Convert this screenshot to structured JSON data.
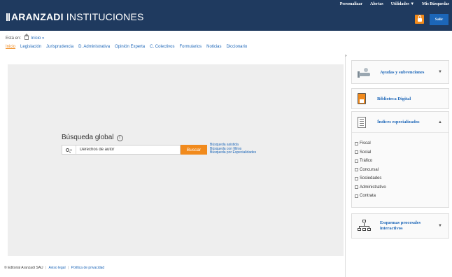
{
  "header": {
    "brand_bold": "ARANZADI",
    "brand_rest": " INSTITUCIONES",
    "links": [
      "Personalizar",
      "Alertas",
      "Utilidades ▼",
      "Mis Búsquedas"
    ],
    "logout_label": "Salir"
  },
  "breadcrumb": {
    "prefix": "Está en:",
    "home": "Inicio »"
  },
  "nav": {
    "items": [
      "Inicio",
      "Legislación",
      "Jurisprudencia",
      "D. Administrativa",
      "Opinión Experta",
      "C. Colectivos",
      "Formularios",
      "Noticias",
      "Diccionario"
    ],
    "active_index": 0
  },
  "search": {
    "title": "Búsqueda global",
    "info_icon": "i",
    "value": "Derechos de autor",
    "button_label": "Buscar",
    "links": [
      "Búsqueda asistida",
      "Búsqueda con filtros",
      "Búsqueda por Especialidades"
    ]
  },
  "sidebar": {
    "ayudas": "Ayudas y subvenciones",
    "biblioteca": "Biblioteca Digital",
    "indices": "Índices especializados",
    "indices_items": [
      "Fiscal",
      "Social",
      "Tráfico",
      "Concursal",
      "Sociedades",
      "Administrativo",
      "Contrata"
    ],
    "esquemas_line1": "Esquemas procesales",
    "esquemas_line2": "interactivos",
    "caret_down": "▼",
    "caret_up": "▲",
    "collapse": "»"
  },
  "footer": {
    "copyright": "© Editorial Aranzadi SAU",
    "links": [
      "Aviso legal",
      "Política de privacidad"
    ]
  },
  "colors": {
    "header_bg": "#1f3a5f",
    "accent": "#f18a1c",
    "link": "#1c66b8",
    "panel_bg": "#eeeeee"
  }
}
